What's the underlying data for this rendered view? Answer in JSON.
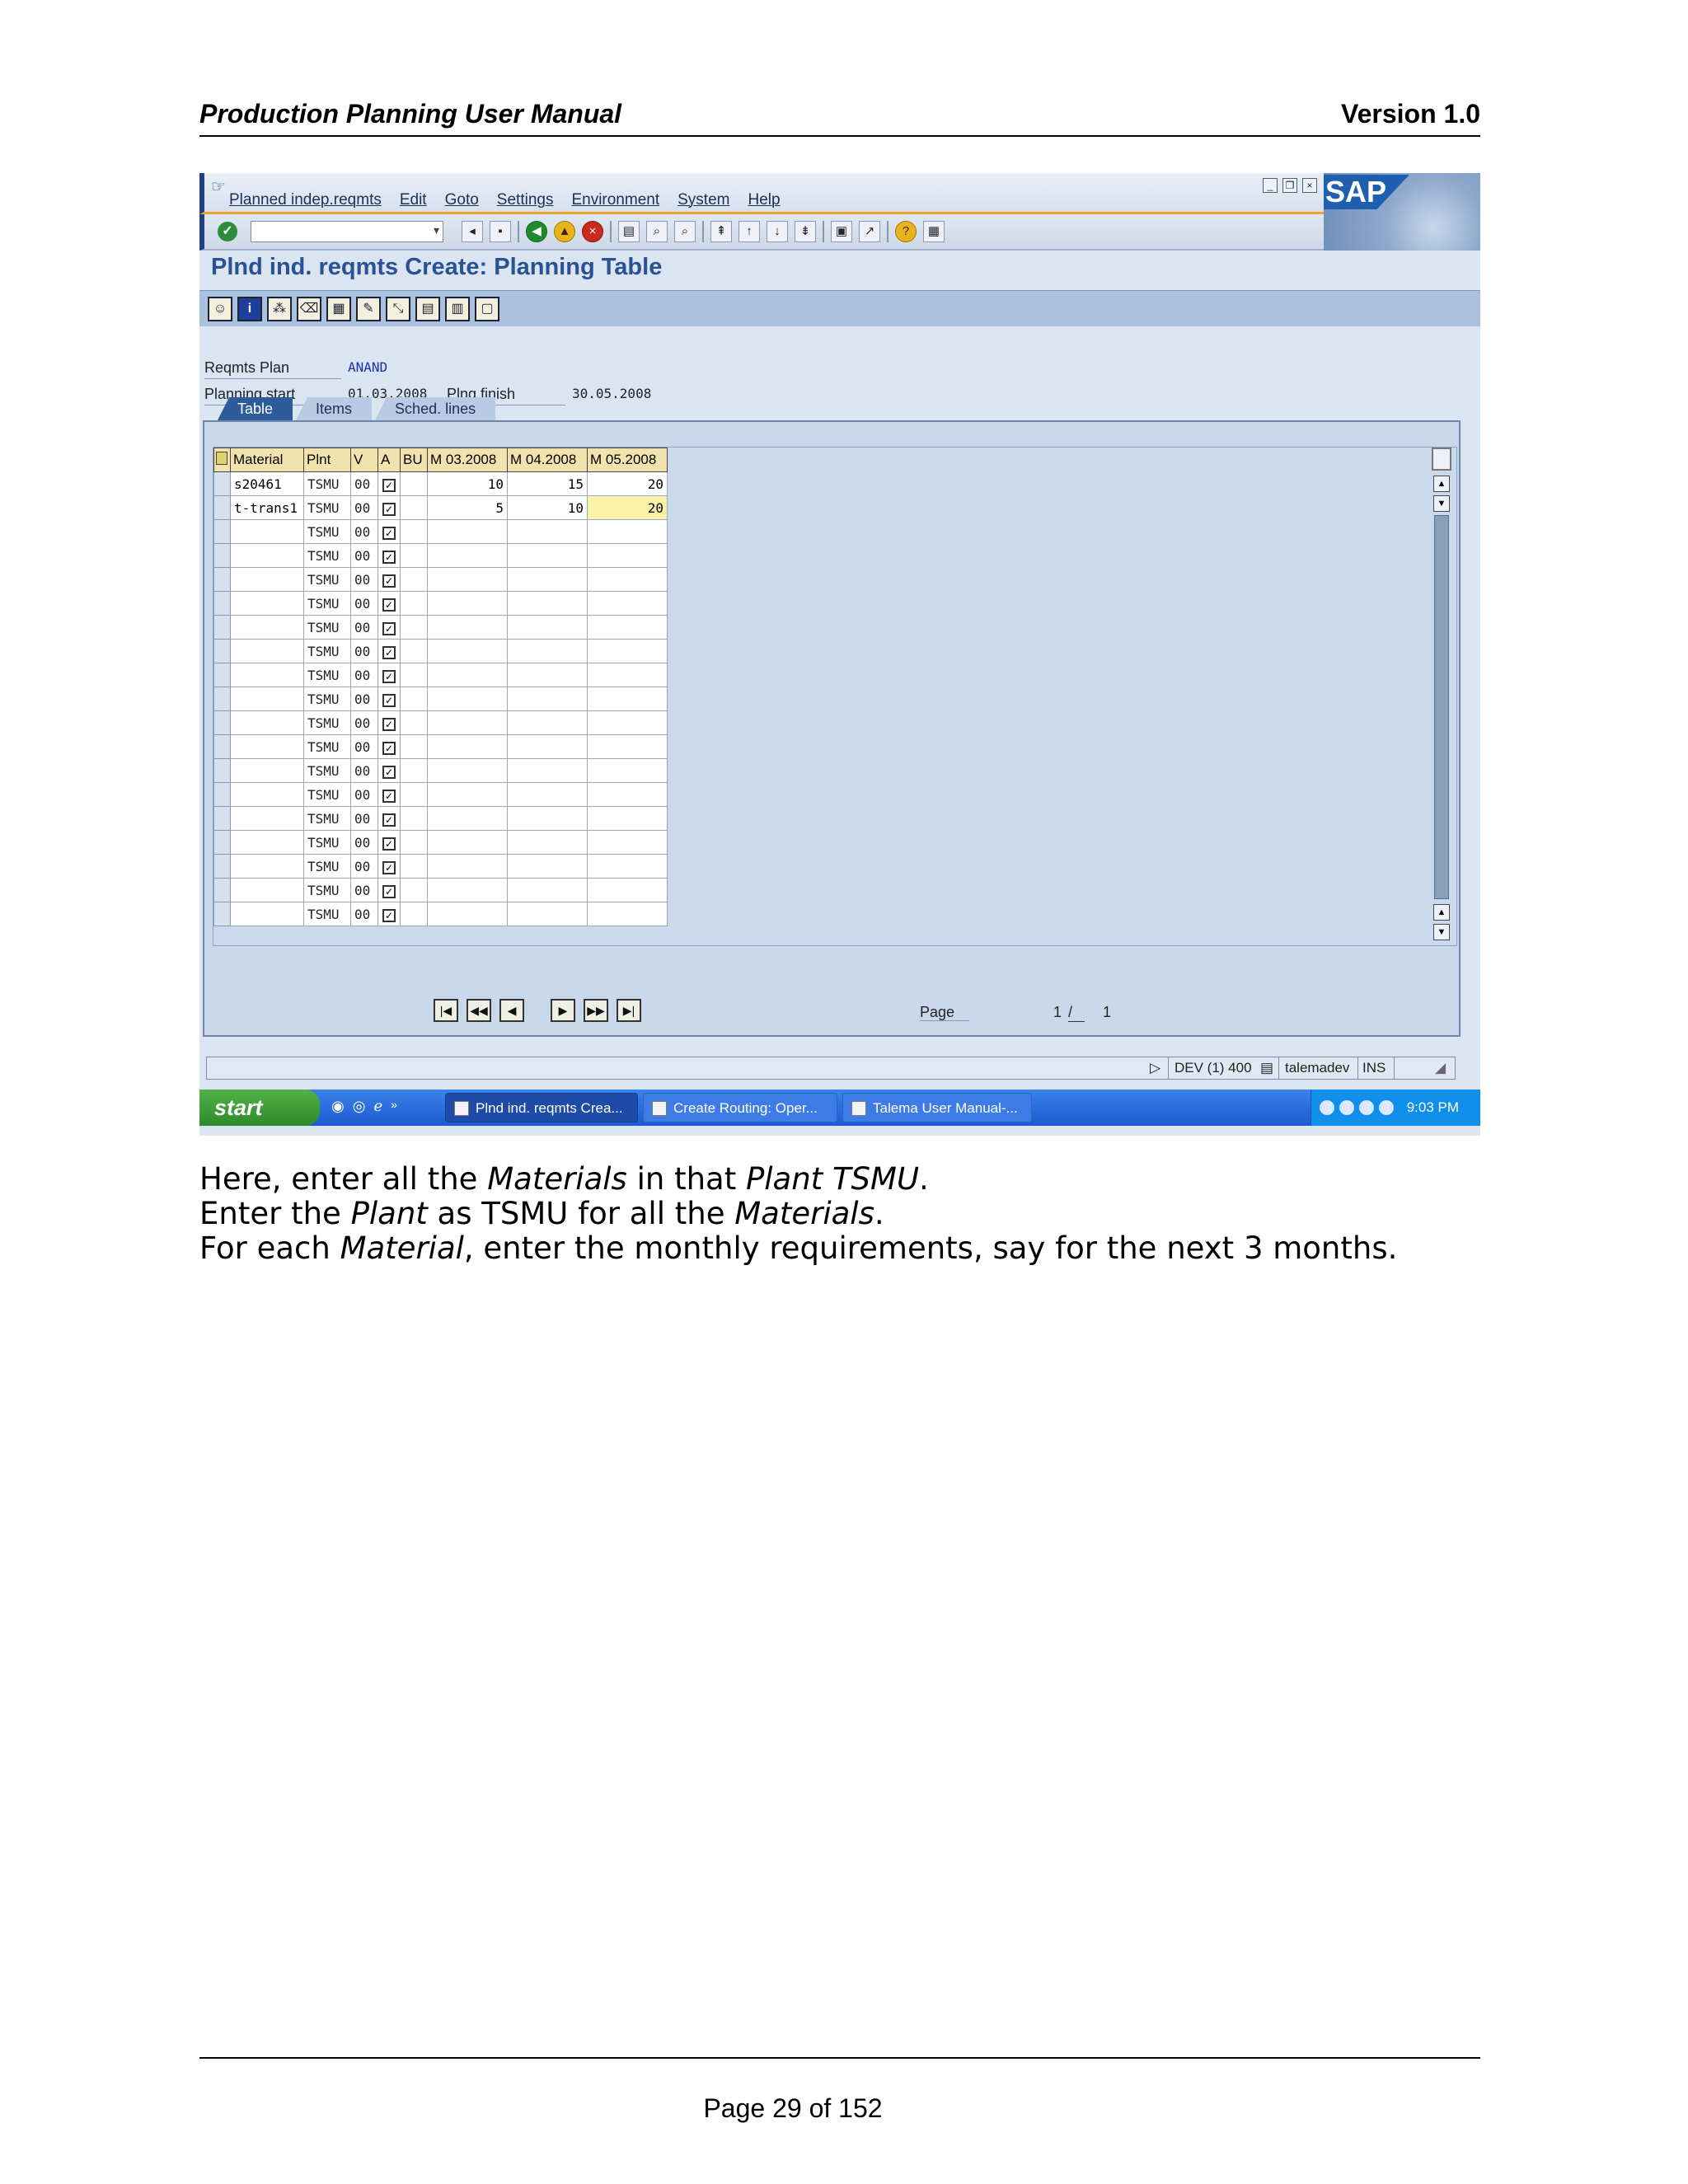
{
  "doc_header": {
    "title": "Production Planning User Manual",
    "version": "Version 1.0"
  },
  "sap": {
    "menu": [
      "Planned indep.reqmts",
      "Edit",
      "Goto",
      "Settings",
      "Environment",
      "System",
      "Help"
    ],
    "logo": "SAP",
    "screen_title": "Plnd ind. reqmts Create: Planning Table",
    "fields": {
      "reqmts_plan_label": "Reqmts Plan",
      "reqmts_plan_value": "ANAND",
      "planning_start_label": "Planning start",
      "planning_start_value": "01.03.2008",
      "plng_finish_label": "Plng finish",
      "plng_finish_value": "30.05.2008"
    },
    "tabs": [
      "Table",
      "Items",
      "Sched. lines"
    ],
    "table": {
      "headers": [
        "Material",
        "Plnt",
        "V",
        "A",
        "BU",
        "M 03.2008",
        "M 04.2008",
        "M 05.2008"
      ],
      "rows": [
        {
          "material": "s20461",
          "plant": "TSMU",
          "version": "00",
          "m03": "10",
          "m04": "15",
          "m05": "20"
        },
        {
          "material": "t-trans1",
          "plant": "TSMU",
          "version": "00",
          "m03": "5",
          "m04": "10",
          "m05": "20"
        },
        {
          "material": "",
          "plant": "TSMU",
          "version": "00",
          "m03": "",
          "m04": "",
          "m05": ""
        },
        {
          "material": "",
          "plant": "TSMU",
          "version": "00",
          "m03": "",
          "m04": "",
          "m05": ""
        },
        {
          "material": "",
          "plant": "TSMU",
          "version": "00",
          "m03": "",
          "m04": "",
          "m05": ""
        },
        {
          "material": "",
          "plant": "TSMU",
          "version": "00",
          "m03": "",
          "m04": "",
          "m05": ""
        },
        {
          "material": "",
          "plant": "TSMU",
          "version": "00",
          "m03": "",
          "m04": "",
          "m05": ""
        },
        {
          "material": "",
          "plant": "TSMU",
          "version": "00",
          "m03": "",
          "m04": "",
          "m05": ""
        },
        {
          "material": "",
          "plant": "TSMU",
          "version": "00",
          "m03": "",
          "m04": "",
          "m05": ""
        },
        {
          "material": "",
          "plant": "TSMU",
          "version": "00",
          "m03": "",
          "m04": "",
          "m05": ""
        },
        {
          "material": "",
          "plant": "TSMU",
          "version": "00",
          "m03": "",
          "m04": "",
          "m05": ""
        },
        {
          "material": "",
          "plant": "TSMU",
          "version": "00",
          "m03": "",
          "m04": "",
          "m05": ""
        },
        {
          "material": "",
          "plant": "TSMU",
          "version": "00",
          "m03": "",
          "m04": "",
          "m05": ""
        },
        {
          "material": "",
          "plant": "TSMU",
          "version": "00",
          "m03": "",
          "m04": "",
          "m05": ""
        },
        {
          "material": "",
          "plant": "TSMU",
          "version": "00",
          "m03": "",
          "m04": "",
          "m05": ""
        },
        {
          "material": "",
          "plant": "TSMU",
          "version": "00",
          "m03": "",
          "m04": "",
          "m05": ""
        },
        {
          "material": "",
          "plant": "TSMU",
          "version": "00",
          "m03": "",
          "m04": "",
          "m05": ""
        },
        {
          "material": "",
          "plant": "TSMU",
          "version": "00",
          "m03": "",
          "m04": "",
          "m05": ""
        },
        {
          "material": "",
          "plant": "TSMU",
          "version": "00",
          "m03": "",
          "m04": "",
          "m05": ""
        }
      ]
    },
    "pager": {
      "label": "Page",
      "current": "1",
      "separator": "/",
      "total": "1"
    },
    "status": {
      "system": "DEV (1) 400",
      "user": "talemadev",
      "mode": "INS"
    },
    "taskbar": {
      "start": "start",
      "tasks": [
        "Plnd ind. reqmts Crea...",
        "Create Routing: Oper...",
        "Talema User Manual-..."
      ],
      "time": "9:03 PM"
    }
  },
  "body": {
    "line1": {
      "a": "Here, enter all the ",
      "b": "Materials",
      "c": " in that ",
      "d": "Plant TSMU",
      "e": "."
    },
    "line2": {
      "a": "Enter the ",
      "b": "Plant",
      "c": " as TSMU for all the ",
      "d": "Materials",
      "e": "."
    },
    "line3": {
      "a": "For each ",
      "b": "Material",
      "c": ", enter the monthly requirements, say for the next 3 months."
    }
  },
  "footer": {
    "page": "Page 29 of 152"
  }
}
